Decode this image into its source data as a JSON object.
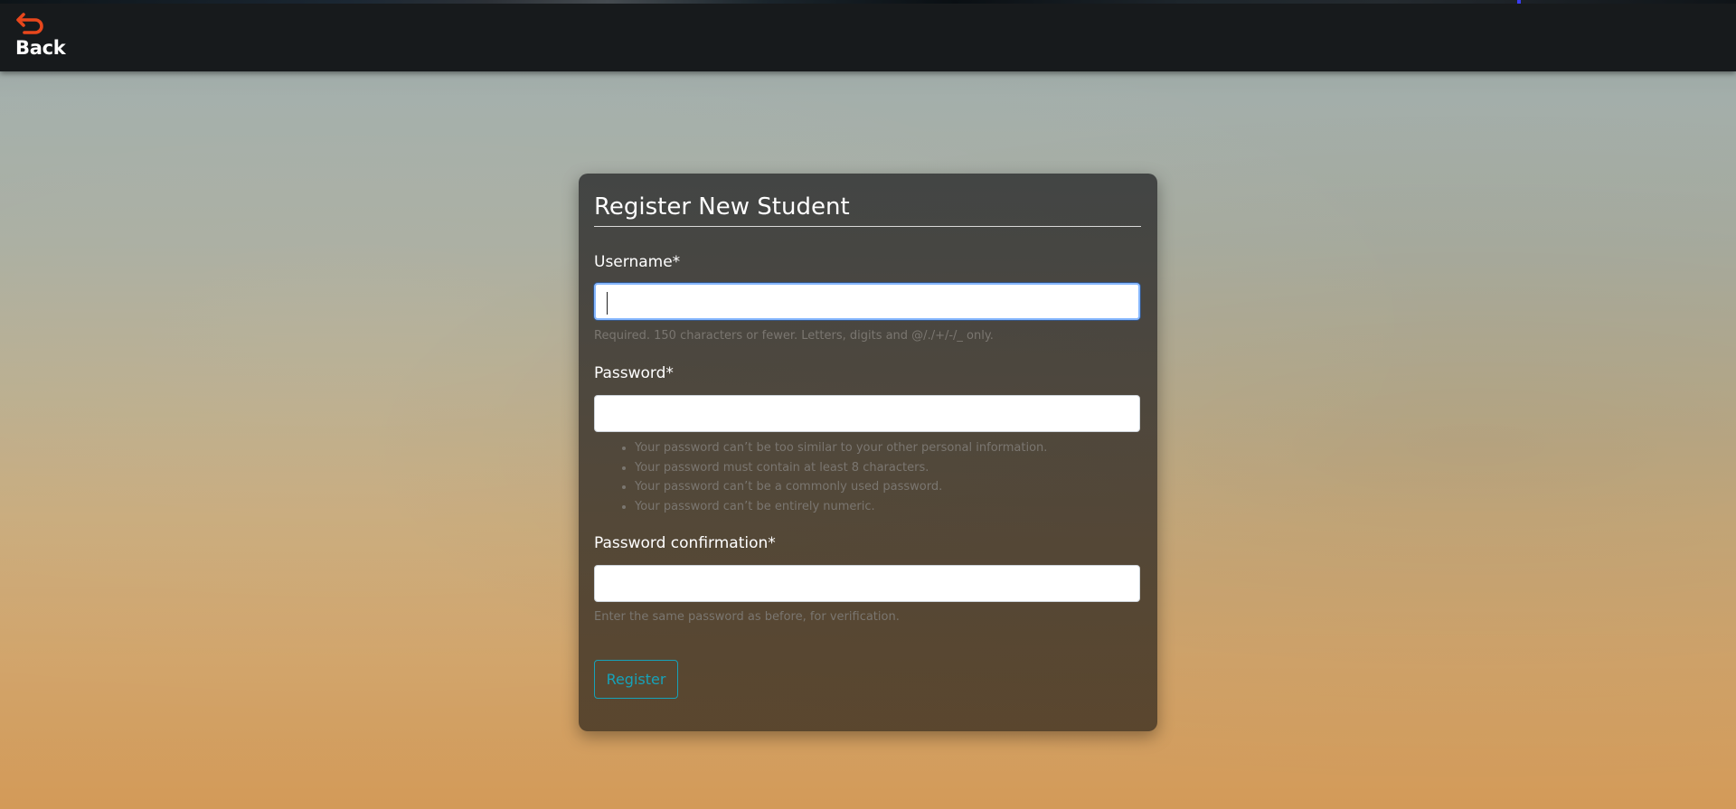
{
  "nav": {
    "back_label": "Back",
    "back_icon": "undo-arrow-icon",
    "icon_color": "#e8471c"
  },
  "form": {
    "title": "Register New Student",
    "username": {
      "label": "Username*",
      "value": "",
      "help": "Required. 150 characters or fewer. Letters, digits and @/./+/-/_ only."
    },
    "password": {
      "label": "Password*",
      "value": "",
      "rules": [
        "Your password can’t be too similar to your other personal information.",
        "Your password must contain at least 8 characters.",
        "Your password can’t be a commonly used password.",
        "Your password can’t be entirely numeric."
      ]
    },
    "password_confirmation": {
      "label": "Password confirmation*",
      "value": "",
      "help": "Enter the same password as before, for verification."
    },
    "submit_label": "Register",
    "accent_color": "#17a2b8"
  }
}
